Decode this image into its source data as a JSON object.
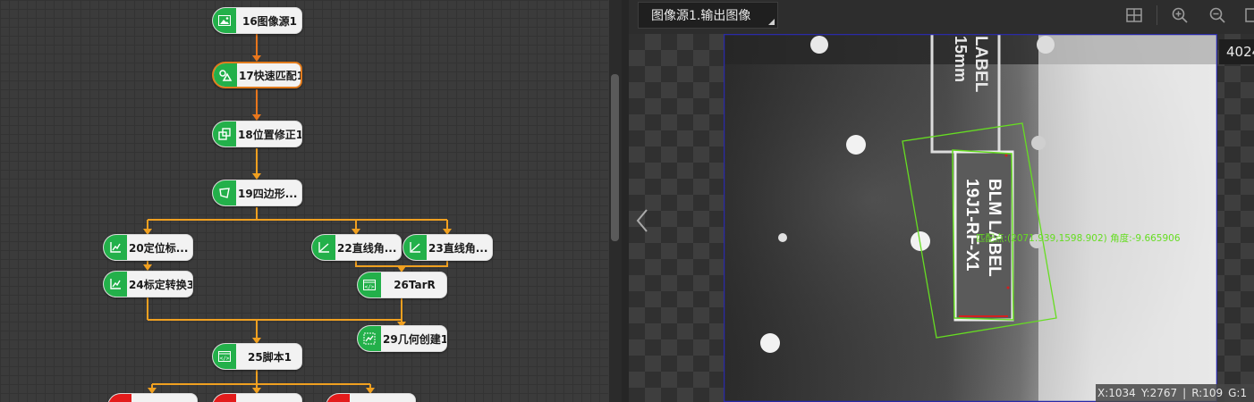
{
  "flow": {
    "nodes": {
      "n16": "16图像源1",
      "n17": "17快速匹配1",
      "n18": "18位置修正1",
      "n19": "19四边形...",
      "n20": "20定位标...",
      "n22": "22直线角...",
      "n23": "23直线角...",
      "n24": "24标定转换3",
      "n26": "26TarR",
      "n29": "29几何创建1",
      "n25": "25脚本1"
    }
  },
  "viewer": {
    "tab_label": "图像源1.输出图像",
    "coord_label": "4024",
    "overlay_text": "匹配点:(2071.939,1598.902) 角度:-9.665906",
    "image_text_1a": "LABEL",
    "image_text_1b": "15mm",
    "image_text_2a": "BLM LABEL",
    "image_text_2b": "19J1-RF-X1",
    "status": {
      "x": "X:1034",
      "y": "Y:2767",
      "sep": "|",
      "r": "R:109",
      "g": "G:1"
    },
    "toolbar_icons": [
      "fit-icon",
      "zoom-in-icon",
      "zoom-out-icon",
      "actual-size-icon"
    ]
  },
  "colors": {
    "node_green": "#23b04a",
    "link_orange": "#f0a020",
    "selected_border": "#e07b1e",
    "overlay_green": "#66dd22"
  }
}
